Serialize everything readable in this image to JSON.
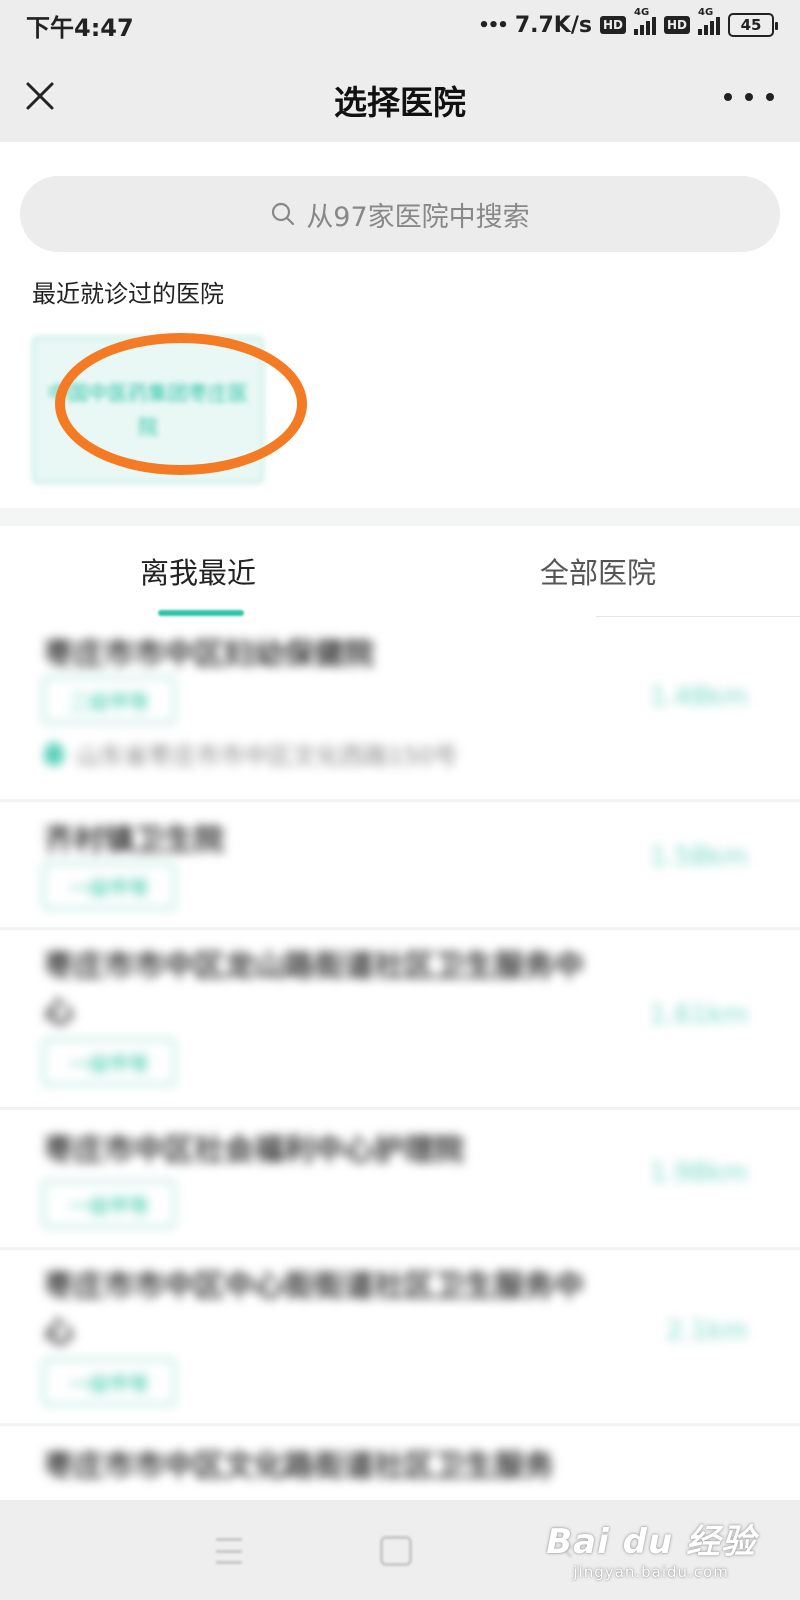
{
  "status_bar": {
    "time": "下午4:47",
    "network_speed": "7.7K/s",
    "hd_label": "HD",
    "network_type": "4G",
    "battery": "45"
  },
  "header": {
    "title": "选择医院",
    "close_icon": "close-icon",
    "more_icon": "more-icon"
  },
  "search": {
    "placeholder": "从97家医院中搜索"
  },
  "recent": {
    "title": "最近就诊过的医院",
    "card_name": "中国中医药集团枣庄医院",
    "highlight_color": "#f47a24"
  },
  "tabs": [
    {
      "label": "离我最近",
      "active": true
    },
    {
      "label": "全部医院",
      "active": false
    }
  ],
  "hospitals": [
    {
      "name": "枣庄市市中区妇幼保健院",
      "level": "二级甲等",
      "distance": "1.48km",
      "address": "山东省枣庄市市中区文化西路150号"
    },
    {
      "name": "齐村镇卫生院",
      "level": "一级甲等",
      "distance": "1.58km"
    },
    {
      "name": "枣庄市市中区龙山路街道社区卫生服务中心",
      "level": "一级甲等",
      "distance": "1.61km"
    },
    {
      "name": "枣庄市中区社会福利中心护理院",
      "level": "一级甲等",
      "distance": "1.98km"
    },
    {
      "name": "枣庄市市中区中心街街道社区卫生服务中心",
      "level": "一级甲等",
      "distance": "2.1km"
    },
    {
      "name": "枣庄市市中区文化路街道社区卫生服务"
    }
  ],
  "watermark": {
    "brand": "Bai du 经验",
    "url": "jingyan.baidu.com"
  },
  "colors": {
    "accent": "#2ec4a8",
    "background_header": "#ededed"
  }
}
